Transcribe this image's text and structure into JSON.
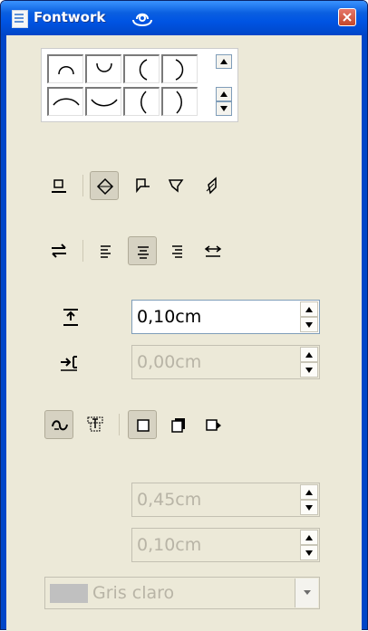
{
  "window": {
    "title": "Fontwork",
    "close_icon": "close-icon"
  },
  "gallery": {
    "shapes": [
      "arch-up-icon",
      "arch-down-icon",
      "arch-left-icon",
      "arch-right-icon",
      "arch-up-open-icon",
      "arch-down-open-icon",
      "arch-left-open-icon",
      "arch-right-open-icon"
    ]
  },
  "toolbar_align": {
    "items": [
      "off-icon",
      "rotate-icon",
      "upright-icon",
      "slant-horizontal-icon",
      "slant-vertical-icon"
    ],
    "pressed": "rotate-icon"
  },
  "toolbar_text": {
    "items": [
      "orientation-icon",
      "align-left-icon",
      "align-center-icon",
      "align-right-icon",
      "autosize-text-icon"
    ],
    "pressed": "align-center-icon"
  },
  "distance": {
    "value": "0,10cm"
  },
  "indent": {
    "value": "0,00cm"
  },
  "toolbar_shadow": {
    "items": [
      "contour-icon",
      "text-frame-icon",
      "no-shadow-icon",
      "vertical-shadow-icon",
      "slant-shadow-icon"
    ],
    "pressed": [
      "contour-icon",
      "no-shadow-icon"
    ]
  },
  "shadow_x": {
    "value": "0,45cm"
  },
  "shadow_y": {
    "value": "0,10cm"
  },
  "shadow_color": {
    "label": "Gris claro",
    "swatch": "#c0c0c0"
  }
}
